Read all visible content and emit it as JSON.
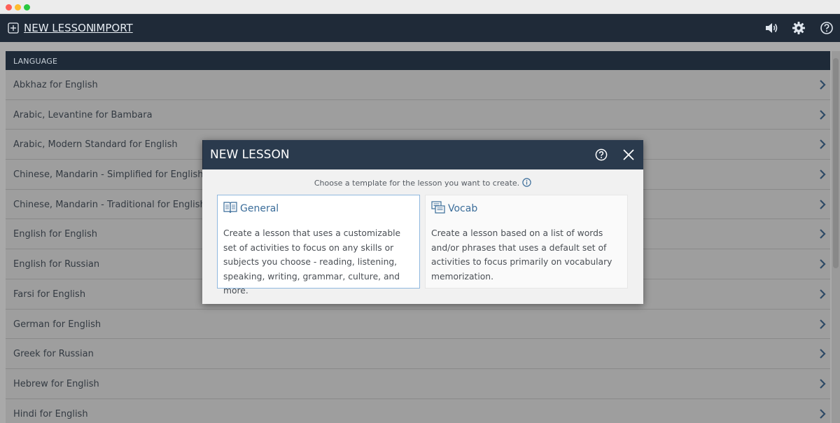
{
  "toolbar": {
    "new_lesson_label": "NEW LESSON",
    "import_label": "IMPORT",
    "icons": [
      "plus-square-icon",
      "speaker-icon",
      "gear-icon",
      "help-icon"
    ]
  },
  "list": {
    "header": "LANGUAGE",
    "items": [
      "Abkhaz for English",
      "Arabic, Levantine for Bambara",
      "Arabic, Modern Standard for English",
      "Chinese, Mandarin - Simplified for English",
      "Chinese, Mandarin - Traditional for English",
      "English for English",
      "English for Russian",
      "Farsi for English",
      "German for English",
      "Greek for Russian",
      "Hebrew for English",
      "Hindi for English"
    ]
  },
  "modal": {
    "title": "NEW LESSON",
    "intro": "Choose a template for the lesson you want to create.",
    "cards": [
      {
        "icon": "open-book-icon",
        "title": "General",
        "description": "Create a lesson that uses a customizable set of activities to focus on any skills or subjects you choose - reading, listening, speaking, writing, grammar, culture, and more."
      },
      {
        "icon": "cards-icon",
        "title": "Vocab",
        "description": "Create a lesson based on a list of words and/or phrases that uses a default set of activities to focus primarily on vocabulary memorization."
      }
    ]
  },
  "colors": {
    "toolbar_bg": "#1f2a38",
    "modal_header_bg": "#2a3a4d",
    "accent": "#3b6d9a",
    "selected_border": "#8fb8de"
  }
}
